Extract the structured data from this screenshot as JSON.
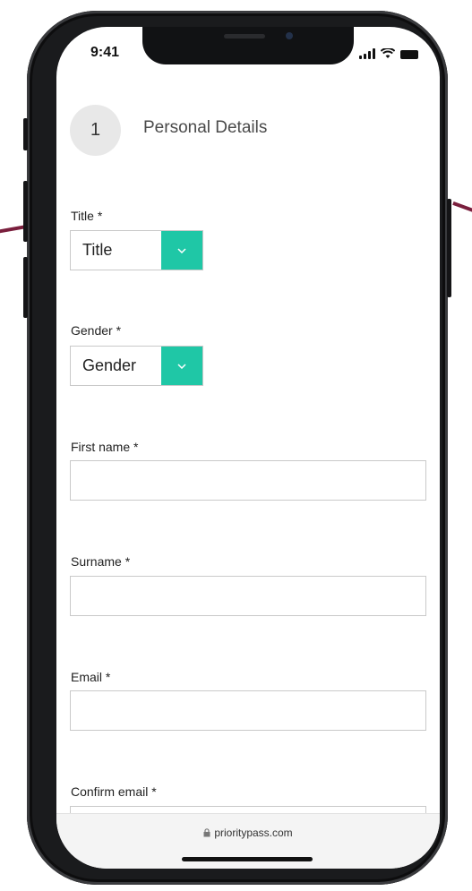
{
  "status_bar": {
    "time": "9:41",
    "icons": [
      "signal-icon",
      "wifi-icon",
      "battery-icon"
    ]
  },
  "step": {
    "number": "1",
    "title": "Personal Details"
  },
  "form": {
    "title_label": "Title *",
    "title_value": "Title",
    "gender_label": "Gender *",
    "gender_value": "Gender",
    "first_name_label": "First name *",
    "first_name_value": "",
    "surname_label": "Surname *",
    "surname_value": "",
    "email_label": "Email *",
    "email_value": "",
    "confirm_email_label": "Confirm email *",
    "confirm_email_value": ""
  },
  "browser": {
    "url": "prioritypass.com",
    "lock_icon": "lock-icon"
  },
  "colors": {
    "accent": "#1fc7a6",
    "frame": "#1a1b1d",
    "background_line": "#7a1f3d"
  }
}
